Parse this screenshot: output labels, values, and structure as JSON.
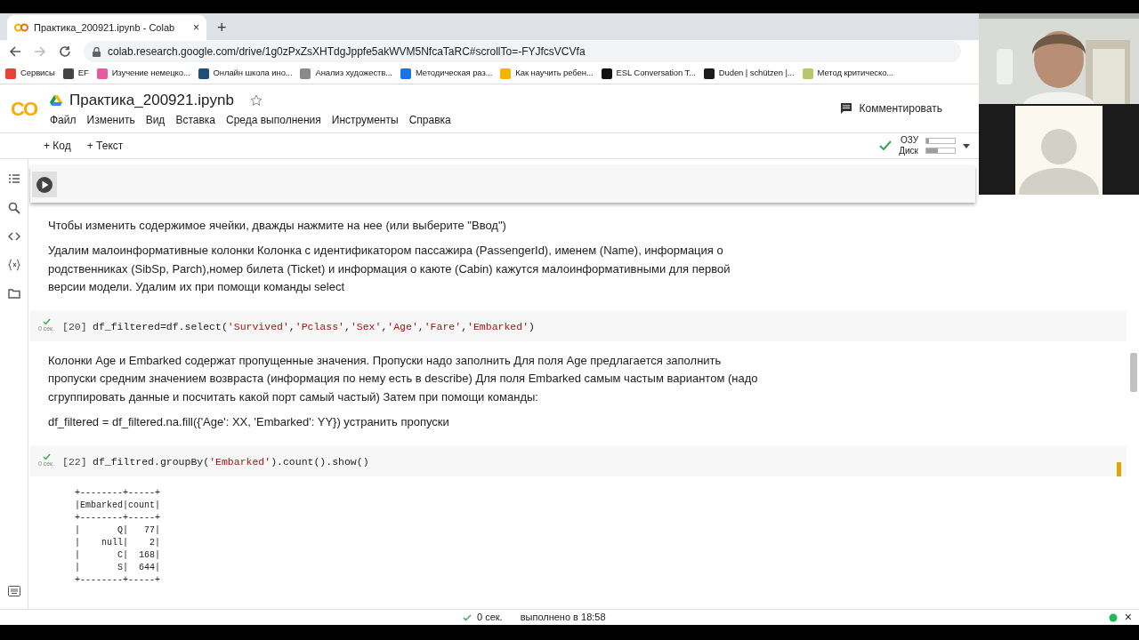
{
  "browser": {
    "tab_title": "Практика_200921.ipynb - Colab",
    "tab_close": "×",
    "new_tab": "+",
    "url": "colab.research.google.com/drive/1g0zPxZsXHTdgJppfe5akWVM5NfcaTaRC#scrollTo=-FYJfcsVCVfa",
    "bookmarks": [
      {
        "label": "Сервисы",
        "color": "#e94235"
      },
      {
        "label": "EF",
        "color": "#444444"
      },
      {
        "label": "Изучение немецко...",
        "color": "#e85aa0"
      },
      {
        "label": "Онлайн школа ино...",
        "color": "#1f4e79"
      },
      {
        "label": "Анализ художеств...",
        "color": "#8a8a8a"
      },
      {
        "label": "Методическая раз...",
        "color": "#1a73e8"
      },
      {
        "label": "Как научить ребен...",
        "color": "#f4b400"
      },
      {
        "label": "ESL Conversation T...",
        "color": "#111111"
      },
      {
        "label": "Duden | schützen |...",
        "color": "#1b1b1b"
      },
      {
        "label": "Метод критическо...",
        "color": "#b5c96a"
      }
    ]
  },
  "notebook": {
    "logo": "CO",
    "title": "Практика_200921.ipynb",
    "starred": false,
    "menu": [
      "Файл",
      "Изменить",
      "Вид",
      "Вставка",
      "Среда выполнения",
      "Инструменты",
      "Справка"
    ],
    "comment_button": "Комментировать",
    "add_buttons": [
      {
        "icon": "+",
        "label": "Код"
      },
      {
        "icon": "+",
        "label": "Текст"
      }
    ],
    "resources": [
      {
        "label": "ОЗУ",
        "level": 0.1
      },
      {
        "label": "Диск",
        "level": 0.4
      }
    ],
    "connected": true
  },
  "cells": [
    {
      "kind": "code",
      "focused": true
    },
    {
      "kind": "text",
      "paragraphs": [
        "Чтобы изменить содержимое ячейки, дважды нажмите на нее (или выберите \"Ввод\")",
        "Удалим малоинформативные колонки Колонка с идентификатором пассажира (PassengerId), именем (Name), информация о родственниках (SibSp, Parch),номер билета (Ticket) и информация о каюте (Cabin) кажутся малоинформативными для первой версии модели. Удалим их при помощи команды select"
      ]
    },
    {
      "kind": "code",
      "exec_count": "[20]",
      "exec_time": "0 сек.",
      "code": "df_filtered=df.select('Survived','Pclass','Sex','Age','Fare','Embarked')"
    },
    {
      "kind": "text",
      "paragraphs": [
        "Колонки Age и Embarked содержат пропущенные значения. Пропуски надо заполнить Для поля Age предлагается заполнить пропуски средним значением возвраста (информация по нему есть в describe) Для поля Embarked самым частым вариантом (надо сгруппировать данные и посчитать какой порт самый частый) Затем при помощи команды:",
        "df_filtered = df_filtered.na.fill({'Age': XX, 'Embarked': YY}) устранить пропуски"
      ]
    },
    {
      "kind": "code",
      "exec_count": "[22]",
      "exec_time": "0 сек.",
      "code": "df_filtred.groupBy('Embarked').count().show()",
      "modified": true,
      "output": "+--------+-----+\n|Embarked|count|\n+--------+-----+\n|       Q|   77|\n|    null|    2|\n|       C|  168|\n|       S|  644|\n+--------+-----+"
    }
  ],
  "status_bar": {
    "ok": true,
    "duration": "0 сек.",
    "executed": "выполнено в 18:58",
    "close": "×"
  }
}
